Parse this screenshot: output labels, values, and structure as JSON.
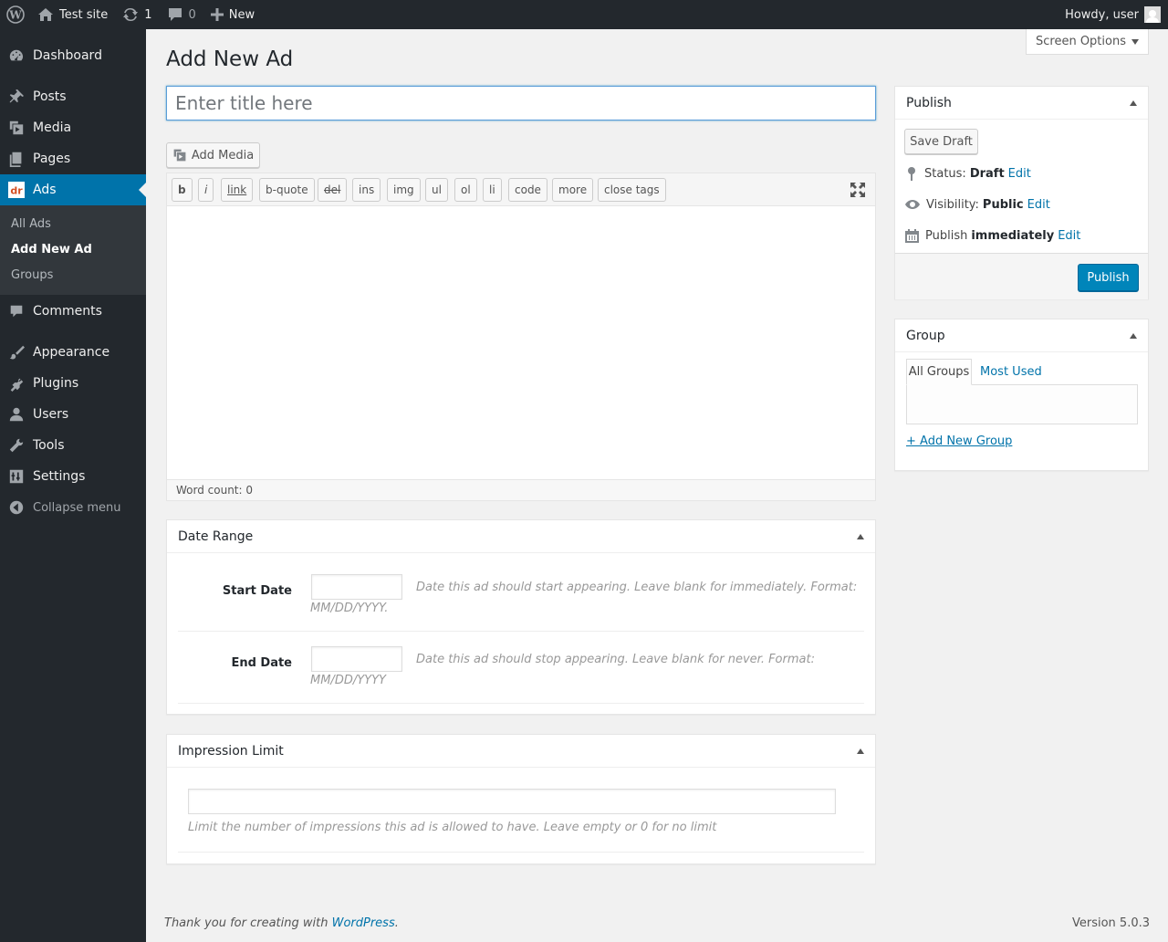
{
  "adminbar": {
    "site_name": "Test site",
    "updates_count": "1",
    "comments_count": "0",
    "new_label": "New",
    "howdy": "Howdy, user"
  },
  "sidebar": {
    "items": [
      {
        "label": "Dashboard",
        "icon": "dashboard-icon"
      },
      {
        "label": "Posts",
        "icon": "pin-icon"
      },
      {
        "label": "Media",
        "icon": "media-icon"
      },
      {
        "label": "Pages",
        "icon": "pages-icon"
      },
      {
        "label": "Ads",
        "icon": "ads-logo-icon"
      },
      {
        "label": "Comments",
        "icon": "comment-icon"
      },
      {
        "label": "Appearance",
        "icon": "paintbrush-icon"
      },
      {
        "label": "Plugins",
        "icon": "plugin-icon"
      },
      {
        "label": "Users",
        "icon": "user-icon"
      },
      {
        "label": "Tools",
        "icon": "wrench-icon"
      },
      {
        "label": "Settings",
        "icon": "settings-icon"
      }
    ],
    "submenu": [
      "All Ads",
      "Add New Ad",
      "Groups"
    ],
    "collapse_label": "Collapse menu",
    "active_color": "#0073aa"
  },
  "screen_options": "Screen Options",
  "page_title": "Add New Ad",
  "title_placeholder": "Enter title here",
  "add_media": "Add Media",
  "toolbar": {
    "buttons": [
      "b",
      "i",
      "link",
      "b-quote",
      "del",
      "ins",
      "img",
      "ul",
      "ol",
      "li",
      "code",
      "more",
      "close tags"
    ]
  },
  "word_count": "Word count: 0",
  "date_range": {
    "title": "Date Range",
    "start_label": "Start Date",
    "start_desc": "Date this ad should start appearing. Leave blank for immediately. Format:",
    "start_format": "MM/DD/YYYY.",
    "end_label": "End Date",
    "end_desc": "Date this ad should stop appearing. Leave blank for never. Format:",
    "end_format": "MM/DD/YYYY"
  },
  "impression": {
    "title": "Impression Limit",
    "desc": "Limit the number of impressions this ad is allowed to have. Leave empty or 0 for no limit"
  },
  "publish": {
    "title": "Publish",
    "save_draft": "Save Draft",
    "status_label": "Status:",
    "status_value": "Draft",
    "visibility_label": "Visibility:",
    "visibility_value": "Public",
    "publish_label": "Publish",
    "publish_value": "immediately",
    "edit": "Edit",
    "publish_button": "Publish",
    "button_color": "#0085ba"
  },
  "group": {
    "title": "Group",
    "tab_all": "All Groups",
    "tab_most": "Most Used",
    "add_new": "+ Add New Group"
  },
  "footer": {
    "thanks_prefix": "Thank you for creating with",
    "wp_link": "WordPress",
    "thanks_suffix": ".",
    "version": "Version 5.0.3"
  }
}
